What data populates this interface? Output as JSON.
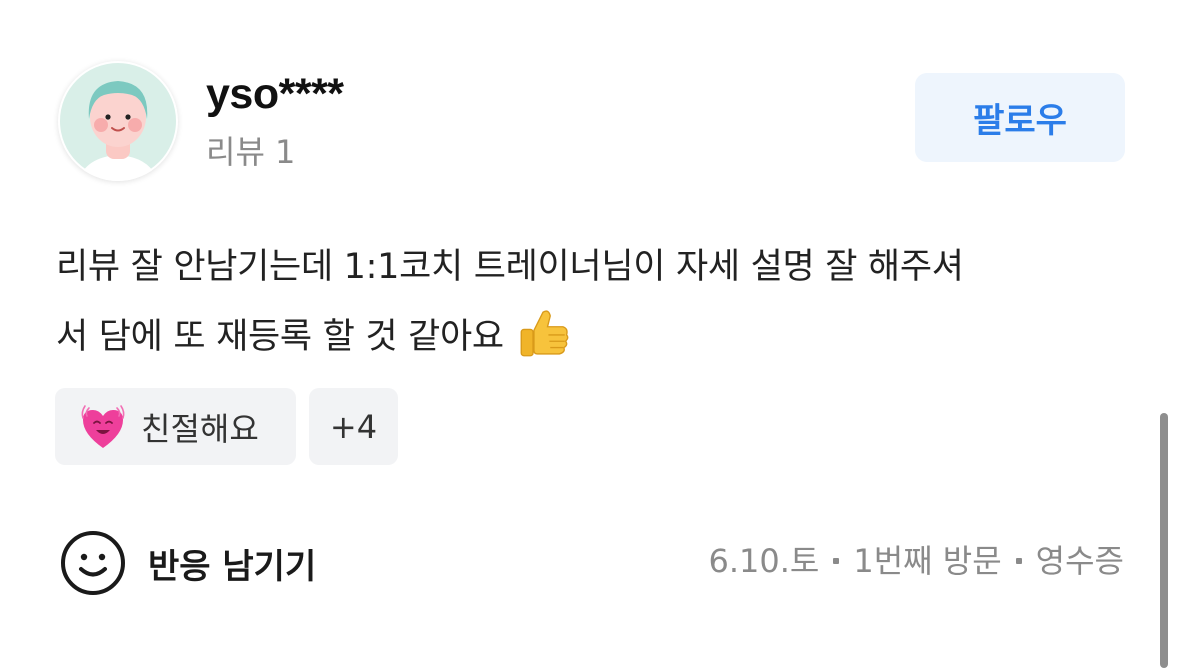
{
  "profile": {
    "username": "yso****",
    "review_count": "리뷰 1",
    "avatar_icon": "user-avatar-illustration"
  },
  "follow_button": {
    "label": "팔로우",
    "color": "#2b7de9",
    "background": "#eef5fd"
  },
  "review": {
    "lines": [
      "리뷰 잘 안남기는데 1:1코치 트레이너님이 자세 설명 잘 해주셔",
      "서 담에 또 재등록 할 것 같아요"
    ],
    "emoji_icon": "thumbs-up-icon"
  },
  "keywords": {
    "items": [
      {
        "icon": "smiling-heart-icon",
        "label": "친절해요"
      }
    ],
    "more_label": "+4"
  },
  "reaction": {
    "icon": "smile-face-icon",
    "label": "반응 남기기"
  },
  "meta": {
    "date": "6.10.토",
    "visit": "1번째 방문",
    "verification": "영수증"
  }
}
